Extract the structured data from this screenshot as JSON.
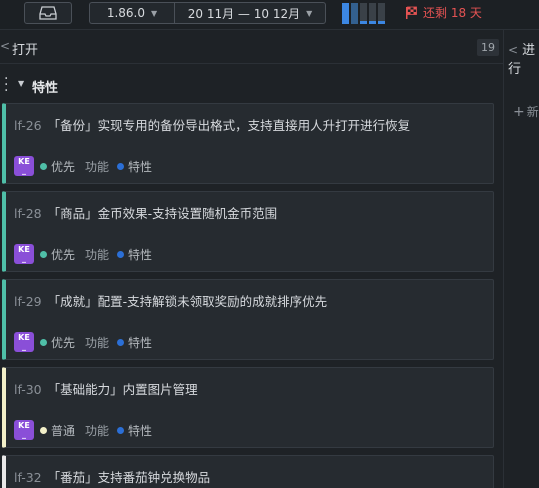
{
  "toolbar": {
    "version": "1.86.0",
    "date_range": "20 11月 — 10 12月",
    "sprint_progress": 0.7,
    "deadline_text": "还剩 18 天"
  },
  "column": {
    "title": "打开",
    "count": "19",
    "next_title": "进行",
    "add_label": "新"
  },
  "group": {
    "title": "特性"
  },
  "colors": {
    "priority_high": "#4fbfa8",
    "priority_normal": "#f3f0c9",
    "tag_feature": "#2b6fd6",
    "avatar": "#8a4fd8",
    "deadline": "#e55353"
  },
  "cards": [
    {
      "id": "lf-26",
      "title": "「备份」实现专用的备份导出格式，支持直接用人升打开进行恢复",
      "avatar": "KE",
      "priority": "优先",
      "priority_color": "#4fbfa8",
      "type": "功能",
      "tag": "特性"
    },
    {
      "id": "lf-28",
      "title": "「商品」金币效果-支持设置随机金币范围",
      "avatar": "KE",
      "priority": "优先",
      "priority_color": "#4fbfa8",
      "type": "功能",
      "tag": "特性"
    },
    {
      "id": "lf-29",
      "title": "「成就」配置-支持解锁未领取奖励的成就排序优先",
      "avatar": "KE",
      "priority": "优先",
      "priority_color": "#4fbfa8",
      "type": "功能",
      "tag": "特性"
    },
    {
      "id": "lf-30",
      "title": "「基础能力」内置图片管理",
      "avatar": "KE",
      "priority": "普通",
      "priority_color": "#f3f0c9",
      "type": "功能",
      "tag": "特性"
    },
    {
      "id": "lf-32",
      "title": "「番茄」支持番茄钟兑换物品",
      "avatar": "KE",
      "priority": "",
      "priority_color": "#e8e8e8",
      "type": "",
      "tag": ""
    }
  ]
}
